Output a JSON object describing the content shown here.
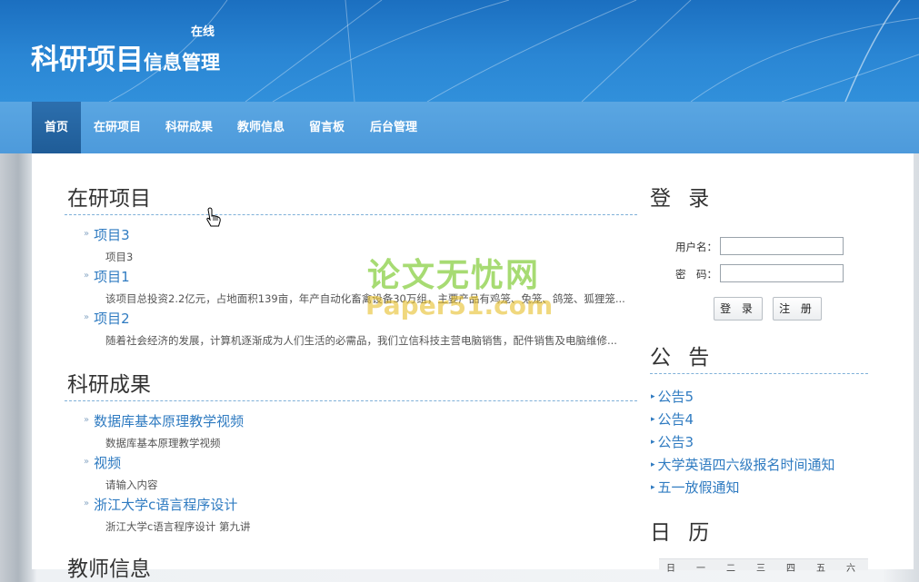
{
  "header": {
    "title_big": "科研项目",
    "title_small": "信息管理",
    "tag": "在线"
  },
  "nav": {
    "items": [
      "首页",
      "在研项目",
      "科研成果",
      "教师信息",
      "留言板",
      "后台管理"
    ],
    "active_index": 0
  },
  "sections": {
    "projects": {
      "title": "在研项目",
      "items": [
        {
          "title": "项目3",
          "desc": "项目3"
        },
        {
          "title": "项目1",
          "desc": "该项目总投资2.2亿元，占地面积139亩，年产自动化畜禽设备30万组，主要产品有鸡笼、兔笼、鸽笼、狐狸笼..."
        },
        {
          "title": "项目2",
          "desc": "随着社会经济的发展，计算机逐渐成为人们生活的必需品，我们立信科技主营电脑销售，配件销售及电脑维修..."
        }
      ]
    },
    "results": {
      "title": "科研成果",
      "items": [
        {
          "title": "数据库基本原理教学视频",
          "desc": "数据库基本原理教学视频"
        },
        {
          "title": "视频",
          "desc": "请输入内容"
        },
        {
          "title": "浙江大学c语言程序设计",
          "desc": "浙江大学c语言程序设计 第九讲"
        }
      ]
    },
    "teachers": {
      "title": "教师信息"
    }
  },
  "login": {
    "title": "登 录",
    "username_label": "用户名：",
    "password_label": "密　码：",
    "username_value": "",
    "password_value": "",
    "login_button": "登 录",
    "register_button": "注 册"
  },
  "notices": {
    "title": "公 告",
    "items": [
      "公告5",
      "公告4",
      "公告3",
      "大学英语四六级报名时间通知",
      "五一放假通知"
    ]
  },
  "calendar": {
    "title": "日 历",
    "weekdays": [
      "日",
      "一",
      "二",
      "三",
      "四",
      "五",
      "六"
    ]
  },
  "watermark": {
    "line1": "论文无忧网",
    "line2": "Paper51.com"
  },
  "colors": {
    "header_blue": "#2a86d4",
    "nav_blue": "#4d9adb",
    "nav_active": "#1f5c97",
    "link_blue": "#2f7bc1"
  }
}
